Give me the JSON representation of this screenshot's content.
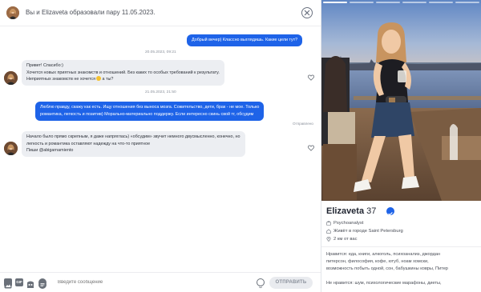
{
  "header": {
    "title": "Вы и Elizaveta образовали пару 11.05.2023."
  },
  "messages": {
    "m1": {
      "lines": [
        "Добрый вечер) Классно выглядишь. Какие цели тут?"
      ]
    },
    "ts1": "20.05.2023, 09:21",
    "m2": {
      "lines": [
        "Привет! Спасибо:)",
        "Хочется новых приятных знакомств и отношений. Без каких то особых требований к результату.",
        "Неприятных знакомств не хочется",
        " а ты?"
      ]
    },
    "ts2": "21.05.2023, 21:50",
    "m3": {
      "lines": [
        "Люблю правду, скажу как есть. Ищу отношения без выноса мозга. Сожительство, дети, брак - не мое. Только",
        "романтика, легкость и позитив) Морально-материально поддержу. Если интересно скинь свой тг, обсудим"
      ]
    },
    "m3_status": "Отправлено",
    "m4": {
      "lines": [
        "Начало было прямо скрепным, я даже напряглась) «обсудим» звучит немного двусмысленно, конечно, но",
        "легкость и романтика оставляют надежду на что-то приятное",
        "Пиши @abigarnamiento"
      ]
    }
  },
  "composer": {
    "placeholder": "Введите сообщение",
    "send_label": "ОТПРАВИТЬ",
    "gif_label": "GIF"
  },
  "profile": {
    "name": "Elizaveta",
    "age": "37",
    "job": "Psychoanalyst",
    "city": "Живёт в городе Saint Petersburg",
    "distance": "2 км от вас",
    "likes": [
      "Нравится: еда, книги, алкоголь, психоанализ, джордан",
      "питерсон, философия, кофе, ютуб, ноам хомски,",
      "возможность побыть одной, сон, бабушкины ковры, Питер"
    ],
    "dislikes": "Не нравится: шум, психологические марафоны, диеты,",
    "photo_segments_total": 6,
    "photo_segment_active": 1
  },
  "colors": {
    "accent": "#1e63e8",
    "bubble_in": "#eceef2"
  }
}
